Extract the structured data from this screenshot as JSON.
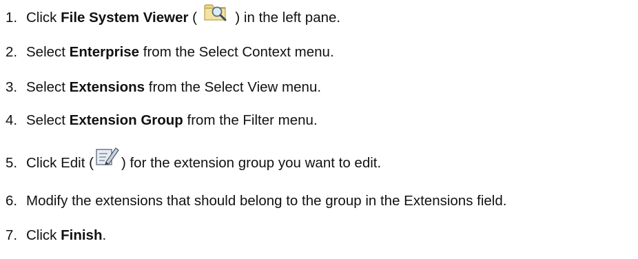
{
  "steps": [
    {
      "number": "1.",
      "before": "Click ",
      "bold": "File System Viewer",
      "mid": " ( ",
      "icon": "folder-search-icon",
      "after": " ) in the left pane."
    },
    {
      "number": "2.",
      "before": "Select ",
      "bold": "Enterprise",
      "after": " from the Select Context menu."
    },
    {
      "number": "3.",
      "before": "Select ",
      "bold": "Extensions",
      "after": " from the Select View menu."
    },
    {
      "number": "4.",
      "before": "Select ",
      "bold": "Extension Group",
      "after": " from the Filter menu."
    },
    {
      "number": "5.",
      "before": "Click Edit (",
      "icon": "edit-icon",
      "after": ") for the extension group you want to edit."
    },
    {
      "number": "6.",
      "text": "Modify the extensions that should belong to the group in the Extensions field."
    },
    {
      "number": "7.",
      "before": "Click ",
      "bold": "Finish",
      "after": "."
    }
  ]
}
